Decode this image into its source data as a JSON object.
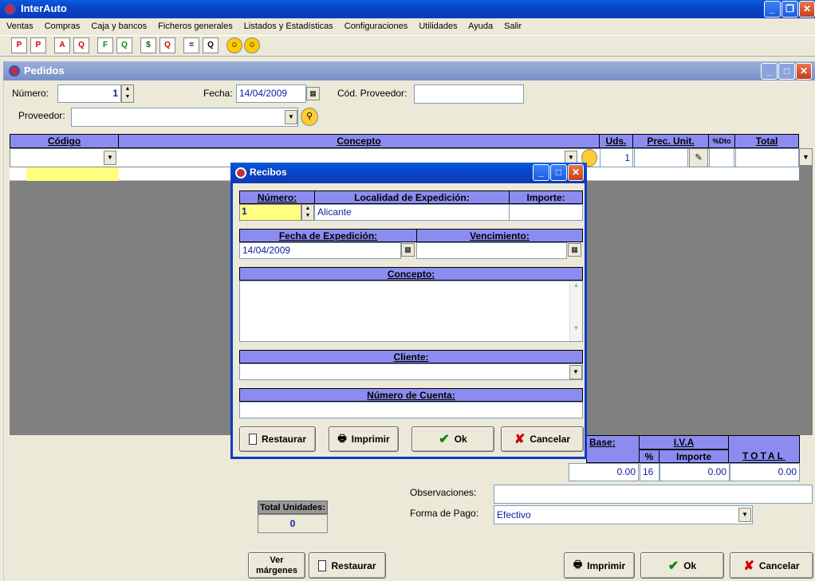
{
  "app": {
    "title": "InterAuto"
  },
  "menu": [
    "Ventas",
    "Compras",
    "Caja y bancos",
    "Ficheros generales",
    "Listados y Estadísticas",
    "Configuraciones",
    "Utilidades",
    "Ayuda",
    "Salir"
  ],
  "toolbar": [
    "P",
    "P",
    "A",
    "Q",
    "F",
    "Q",
    "$",
    "Q",
    "=",
    "Q",
    "☺",
    "☺"
  ],
  "pedidos": {
    "title": "Pedidos",
    "numero_label": "Número:",
    "numero_value": "1",
    "fecha_label": "Fecha:",
    "fecha_value": "14/04/2009",
    "cod_proveedor_label": "Cód. Proveedor:",
    "cod_proveedor_value": "",
    "proveedor_label": "Proveedor:",
    "proveedor_value": "",
    "columns": {
      "codigo": "Código",
      "concepto": "Concepto",
      "uds": "Uds.",
      "prec": "Prec. Unit.",
      "dto": "%Dto",
      "total": "Total"
    },
    "row_uds": "1",
    "totals": {
      "base_label": "Base:",
      "iva_label": "I.V.A",
      "pct_label": "%",
      "importe_label": "Importe",
      "total_label": "TOTAL",
      "base": "0.00",
      "pct": "16",
      "importe": "0.00",
      "total": "0.00"
    },
    "observaciones_label": "Observaciones:",
    "observaciones_value": "",
    "forma_pago_label": "Forma de Pago:",
    "forma_pago_value": "Efectivo",
    "total_unidades_label": "Total Unidades:",
    "total_unidades": "0",
    "buttons": {
      "ver_margenes": "Ver márgenes",
      "restaurar": "Restaurar",
      "imprimir": "Imprimir",
      "ok": "Ok",
      "cancelar": "Cancelar"
    }
  },
  "recibos": {
    "title": "Recibos",
    "numero_label": "Número:",
    "numero_value": "1",
    "localidad_label": "Localidad de Expedición:",
    "localidad_value": "Alicante",
    "importe_label": "Importe:",
    "importe_value": "",
    "fecha_exp_label": "Fecha de Expedición:",
    "fecha_exp_value": "14/04/2009",
    "vencimiento_label": "Vencimiento:",
    "vencimiento_value": "",
    "concepto_label": "Concepto:",
    "cliente_label": "Cliente:",
    "cliente_value": "",
    "cuenta_label": "Número de Cuenta:",
    "cuenta_value": "",
    "buttons": {
      "restaurar": "Restaurar",
      "imprimir": "Imprimir",
      "ok": "Ok",
      "cancelar": "Cancelar"
    }
  }
}
